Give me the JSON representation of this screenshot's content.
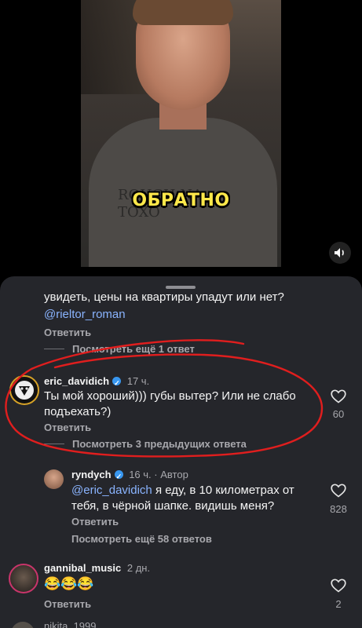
{
  "video": {
    "caption": "ОБРАТНО",
    "shirt_print": "ROUGH NA\nTOXO",
    "sound_icon": "speaker-icon"
  },
  "comments": {
    "prev_tail": {
      "text": "увидеть, цены на квартиры упадут или нет?",
      "mention": "@rieltor_roman",
      "reply_label": "Ответить",
      "view_more": "Посмотреть ещё 1 ответ"
    },
    "c1": {
      "username": "eric_davidich",
      "time": "17 ч.",
      "line1": "Ты мой хороший))) губы вытер? Или не слабо",
      "line2": "подъехать?)",
      "reply_label": "Ответить",
      "likes": "60",
      "view_more": "Посмотреть 3 предыдущих ответа"
    },
    "c2": {
      "username": "ryndych",
      "time": "16 ч.",
      "author_tag": "· Автор",
      "mention": "@eric_davidich",
      "line1_rest": " я еду, в 10 километрах от",
      "line2": "тебя, в чёрной шапке. видишь меня?",
      "reply_label": "Ответить",
      "likes": "828",
      "view_more": "Посмотреть ещё 58 ответов"
    },
    "c3": {
      "username": "gannibal_music",
      "time": "2 дн.",
      "text": "😂😂😂",
      "reply_label": "Ответить",
      "likes": "2"
    },
    "c4_partial": {
      "username": "nikita_1999..."
    }
  },
  "colors": {
    "sheet_bg": "#25262b",
    "annotation": "#e01e1e",
    "caption": "#ffe84a",
    "link": "#8ab4ff"
  }
}
